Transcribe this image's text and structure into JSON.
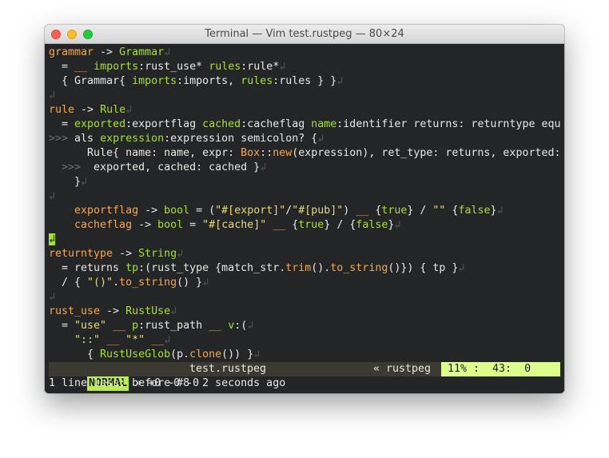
{
  "window": {
    "title": "Terminal — Vim test.rustpeg — 80×24"
  },
  "buffer_lines": [
    [
      {
        "t": "grammar",
        "c": "nt"
      },
      {
        "t": " -> ",
        "c": "op"
      },
      {
        "t": "Grammar",
        "c": "ty"
      },
      {
        "t": "↲",
        "c": "eol"
      }
    ],
    [
      {
        "t": "  = ",
        "c": "op"
      },
      {
        "t": "__",
        "c": "nt"
      },
      {
        "t": " ",
        "c": "op"
      },
      {
        "t": "imports",
        "c": "fn"
      },
      {
        "t": ":rust_use",
        "c": "plain"
      },
      {
        "t": "*",
        "c": "op"
      },
      {
        "t": " ",
        "c": "op"
      },
      {
        "t": "rules",
        "c": "fn"
      },
      {
        "t": ":rule",
        "c": "plain"
      },
      {
        "t": "*",
        "c": "op"
      },
      {
        "t": "↲",
        "c": "eol"
      }
    ],
    [
      {
        "t": "  { Grammar{ ",
        "c": "plain"
      },
      {
        "t": "imports",
        "c": "fn"
      },
      {
        "t": ":imports, ",
        "c": "plain"
      },
      {
        "t": "rules",
        "c": "fn"
      },
      {
        "t": ":rules } }",
        "c": "plain"
      },
      {
        "t": "↲",
        "c": "eol"
      }
    ],
    [
      {
        "t": "↲",
        "c": "eol"
      }
    ],
    [
      {
        "t": "rule",
        "c": "nt"
      },
      {
        "t": " -> ",
        "c": "op"
      },
      {
        "t": "Rule",
        "c": "ty"
      },
      {
        "t": "↲",
        "c": "eol"
      }
    ],
    [
      {
        "t": "  = ",
        "c": "op"
      },
      {
        "t": "exported",
        "c": "fn"
      },
      {
        "t": ":exportflag ",
        "c": "plain"
      },
      {
        "t": "cached",
        "c": "fn"
      },
      {
        "t": ":cacheflag ",
        "c": "plain"
      },
      {
        "t": "name",
        "c": "fn"
      },
      {
        "t": ":identifier returns: returntype equ",
        "c": "plain"
      }
    ],
    [
      {
        "t": ">>> ",
        "c": "brk"
      },
      {
        "t": "als ",
        "c": "plain"
      },
      {
        "t": "expression",
        "c": "fn"
      },
      {
        "t": ":expression semicolon? {",
        "c": "plain"
      },
      {
        "t": "↲",
        "c": "eol"
      }
    ],
    [
      {
        "t": "      Rule{ name: name, expr: ",
        "c": "plain"
      },
      {
        "t": "Box",
        "c": "nt"
      },
      {
        "t": "::",
        "c": "plain"
      },
      {
        "t": "new",
        "c": "nt"
      },
      {
        "t": "(expression), ret_type: returns, exported:",
        "c": "plain"
      }
    ],
    [
      {
        "t": "  >>> ",
        "c": "brk"
      },
      {
        "t": " exported, cached: cached }",
        "c": "plain"
      },
      {
        "t": "↲",
        "c": "eol"
      }
    ],
    [
      {
        "t": "    }",
        "c": "plain"
      },
      {
        "t": "↲",
        "c": "eol"
      }
    ],
    [
      {
        "t": "↲",
        "c": "eol"
      }
    ],
    [
      {
        "t": "    exportflag",
        "c": "nt"
      },
      {
        "t": " -> ",
        "c": "op"
      },
      {
        "t": "bool",
        "c": "ty"
      },
      {
        "t": " = (",
        "c": "plain"
      },
      {
        "t": "\"#[export]\"",
        "c": "str"
      },
      {
        "t": "/",
        "c": "op"
      },
      {
        "t": "\"#[pub]\"",
        "c": "str"
      },
      {
        "t": ") ",
        "c": "plain"
      },
      {
        "t": "__",
        "c": "nt"
      },
      {
        "t": " {",
        "c": "plain"
      },
      {
        "t": "true",
        "c": "fn"
      },
      {
        "t": "} / ",
        "c": "plain"
      },
      {
        "t": "\"\"",
        "c": "str"
      },
      {
        "t": " {",
        "c": "plain"
      },
      {
        "t": "false",
        "c": "fn"
      },
      {
        "t": "}",
        "c": "plain"
      },
      {
        "t": "↲",
        "c": "eol"
      }
    ],
    [
      {
        "t": "    cacheflag",
        "c": "nt"
      },
      {
        "t": " -> ",
        "c": "op"
      },
      {
        "t": "bool",
        "c": "ty"
      },
      {
        "t": " = ",
        "c": "plain"
      },
      {
        "t": "\"#[cache]\"",
        "c": "str"
      },
      {
        "t": " ",
        "c": "plain"
      },
      {
        "t": "__",
        "c": "nt"
      },
      {
        "t": " {",
        "c": "plain"
      },
      {
        "t": "true",
        "c": "fn"
      },
      {
        "t": "} / {",
        "c": "plain"
      },
      {
        "t": "false",
        "c": "fn"
      },
      {
        "t": "}",
        "c": "plain"
      },
      {
        "t": "↲",
        "c": "eol"
      }
    ],
    [
      {
        "t": "↲",
        "c": "cur"
      }
    ],
    [
      {
        "t": "returntype",
        "c": "nt"
      },
      {
        "t": " -> ",
        "c": "op"
      },
      {
        "t": "String",
        "c": "ty"
      },
      {
        "t": "↲",
        "c": "eol"
      }
    ],
    [
      {
        "t": "  = returns ",
        "c": "plain"
      },
      {
        "t": "tp",
        "c": "fn"
      },
      {
        "t": ":(rust_type {match_str.",
        "c": "plain"
      },
      {
        "t": "trim",
        "c": "nt"
      },
      {
        "t": "().",
        "c": "plain"
      },
      {
        "t": "to_string",
        "c": "nt"
      },
      {
        "t": "()}) { tp }",
        "c": "plain"
      },
      {
        "t": "↲",
        "c": "eol"
      }
    ],
    [
      {
        "t": "  / { ",
        "c": "plain"
      },
      {
        "t": "\"()\"",
        "c": "str"
      },
      {
        "t": ".",
        "c": "plain"
      },
      {
        "t": "to_string",
        "c": "nt"
      },
      {
        "t": "() }",
        "c": "plain"
      },
      {
        "t": "↲",
        "c": "eol"
      }
    ],
    [
      {
        "t": "↲",
        "c": "eol"
      }
    ],
    [
      {
        "t": "rust_use",
        "c": "nt"
      },
      {
        "t": " -> ",
        "c": "op"
      },
      {
        "t": "RustUse",
        "c": "ty"
      },
      {
        "t": "↲",
        "c": "eol"
      }
    ],
    [
      {
        "t": "  = ",
        "c": "plain"
      },
      {
        "t": "\"use\"",
        "c": "str"
      },
      {
        "t": " ",
        "c": "plain"
      },
      {
        "t": "__",
        "c": "nt"
      },
      {
        "t": " ",
        "c": "plain"
      },
      {
        "t": "p",
        "c": "fn"
      },
      {
        "t": ":rust_path ",
        "c": "plain"
      },
      {
        "t": "__",
        "c": "nt"
      },
      {
        "t": " ",
        "c": "plain"
      },
      {
        "t": "v",
        "c": "fn"
      },
      {
        "t": ":(",
        "c": "plain"
      },
      {
        "t": "↲",
        "c": "eol"
      }
    ],
    [
      {
        "t": "    ",
        "c": "plain"
      },
      {
        "t": "\"::\"",
        "c": "str"
      },
      {
        "t": " ",
        "c": "plain"
      },
      {
        "t": "__",
        "c": "nt"
      },
      {
        "t": " ",
        "c": "plain"
      },
      {
        "t": "\"*\"",
        "c": "str"
      },
      {
        "t": " ",
        "c": "plain"
      },
      {
        "t": "__",
        "c": "nt"
      },
      {
        "t": "↲",
        "c": "eol"
      }
    ],
    [
      {
        "t": "      { ",
        "c": "plain"
      },
      {
        "t": "RustUseGlob",
        "c": "ty"
      },
      {
        "t": "(p.",
        "c": "plain"
      },
      {
        "t": "clone",
        "c": "nt"
      },
      {
        "t": "()) }",
        "c": "plain"
      },
      {
        "t": "↲",
        "c": "eol"
      }
    ]
  ],
  "statusline": {
    "mode": "NORMAL",
    "git_info": " » +0 ~0 -0",
    "filename": "test.rustpeg",
    "filetype": "« rustpeg  «",
    "position": " 11% :  43:  0"
  },
  "cmdline": {
    "message": "1 line less; before #8  2 seconds ago"
  },
  "colors": {
    "background": "#232526",
    "nonterminal": "#f8a64a",
    "type_and_label": "#a6e22e",
    "string": "#e6db74",
    "eol_marker": "#545454",
    "mode_badge": "#b8ec52",
    "position_badge": "#dbff8a"
  },
  "icons": {
    "close": "close-icon",
    "minimize": "minimize-icon",
    "zoom": "zoom-icon"
  }
}
